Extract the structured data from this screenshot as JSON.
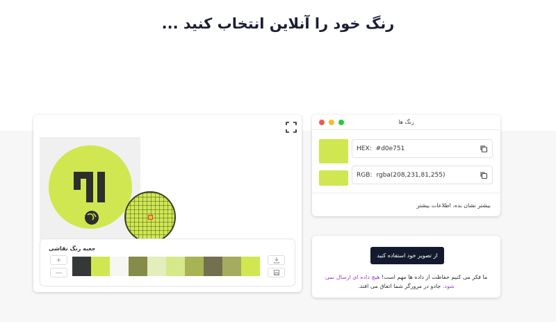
{
  "page": {
    "title": "رنگ خود را آنلاین انتخاب کنید ..."
  },
  "picker": {
    "palette_title": "جعبه رنگ نقاشی",
    "add_label": "+",
    "remove_label": "—",
    "swatches": [
      "#343836",
      "#d0e751",
      "#f6f6f2",
      "#848c48",
      "#e2eebb",
      "#d6e98a",
      "#a8b454",
      "#72704e",
      "#a5ac60",
      "#d0e751"
    ],
    "image_icons": [
      "globe-icon"
    ],
    "sample_color": "#d0e751"
  },
  "colors": {
    "window_title": "رنگ ها",
    "hex_label": "HEX:",
    "hex_value": "#d0e751",
    "rgb_label": "RGB:",
    "rgb_value": "rgba(208,231,81,255)",
    "more_label": "بیشتر نشان بده، اطلاعات بیشتر",
    "dot_colors": [
      "#ee5a52",
      "#f5bd2f",
      "#29c840"
    ]
  },
  "upload": {
    "button_label": "از تصویر خود استفاده کنید",
    "privacy_before": "ما فکر می کنیم حفاظت از داده ها مهم است!",
    "privacy_highlight": "هیچ داده ای ارسال نمی شود.",
    "privacy_after": "جادو در مرورگر شما اتفاق می افتد."
  }
}
